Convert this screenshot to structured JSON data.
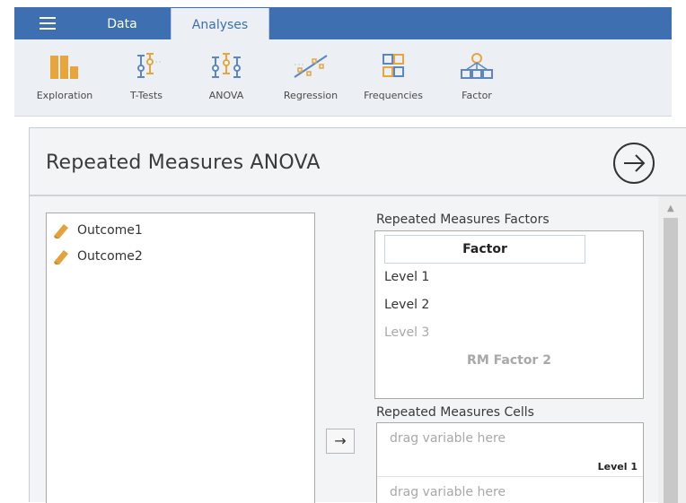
{
  "nav": {
    "tabs": [
      {
        "label": "Data",
        "active": false
      },
      {
        "label": "Analyses",
        "active": true
      }
    ]
  },
  "ribbon": {
    "items": [
      {
        "label": "Exploration",
        "icon": "exploration-icon"
      },
      {
        "label": "T-Tests",
        "icon": "t-tests-icon"
      },
      {
        "label": "ANOVA",
        "icon": "anova-icon"
      },
      {
        "label": "Regression",
        "icon": "regression-icon"
      },
      {
        "label": "Frequencies",
        "icon": "frequencies-icon"
      },
      {
        "label": "Factor",
        "icon": "factor-icon"
      }
    ]
  },
  "panel": {
    "title": "Repeated Measures ANOVA",
    "go_icon": "arrow-right-circle-icon"
  },
  "variables": [
    {
      "name": "Outcome1",
      "icon": "continuous-variable-icon"
    },
    {
      "name": "Outcome2",
      "icon": "continuous-variable-icon"
    }
  ],
  "rm_factors": {
    "label": "Repeated Measures Factors",
    "factor_name": "Factor",
    "levels": [
      "Level 1",
      "Level 2"
    ],
    "level_placeholder": "Level 3",
    "factor_placeholder": "RM Factor 2"
  },
  "rm_cells": {
    "label": "Repeated Measures Cells",
    "cells": [
      {
        "placeholder": "drag variable here",
        "level": "Level 1"
      },
      {
        "placeholder": "drag variable here",
        "level": ""
      }
    ]
  },
  "move_button": {
    "symbol": "→"
  },
  "colors": {
    "brand_blue": "#3e6fb0",
    "variable_orange": "#e3a33a",
    "ribbon_yellow": "#e8a53c",
    "ribbon_blue": "#5a86c5"
  }
}
